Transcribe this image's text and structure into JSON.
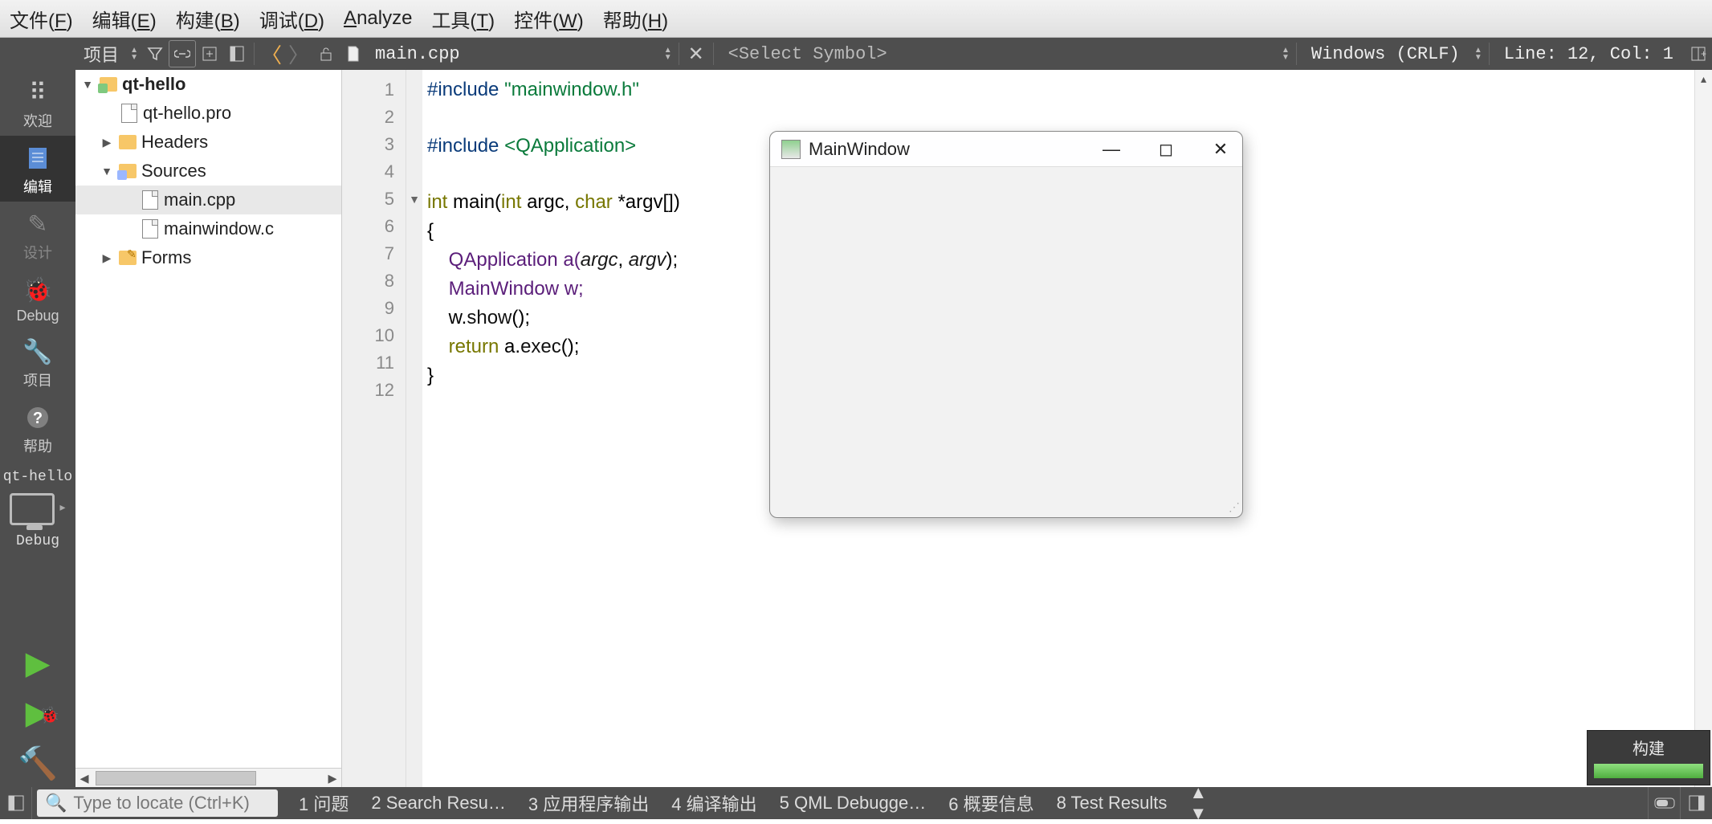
{
  "menu": {
    "file": "文件(",
    "file_k": "F",
    "edit": "编辑(",
    "edit_k": "E",
    "build": "构建(",
    "build_k": "B",
    "debug": "调试(",
    "debug_k": "D",
    "analyze": "Analyze",
    "analyze_k": "A",
    "tools": "工具(",
    "tools_k": "T",
    "widgets": "控件(",
    "widgets_k": "W",
    "help": "帮助(",
    "help_k": "H"
  },
  "toolbar": {
    "project_label": "项目",
    "open_file": "main.cpp",
    "select_symbol": "<Select Symbol>",
    "encoding": "Windows (CRLF)",
    "cursor": "Line: 12, Col: 1"
  },
  "activity": {
    "welcome": "欢迎",
    "edit": "编辑",
    "design": "设计",
    "debug": "Debug",
    "project": "项目",
    "help": "帮助",
    "kit": "qt-hello",
    "config": "Debug"
  },
  "tree": {
    "root": "qt-hello",
    "pro": "qt-hello.pro",
    "headers": "Headers",
    "sources": "Sources",
    "main": "main.cpp",
    "mw": "mainwindow.c",
    "forms": "Forms"
  },
  "gutter": [
    "1",
    "2",
    "3",
    "4",
    "5",
    "6",
    "7",
    "8",
    "9",
    "10",
    "11",
    "12"
  ],
  "code": {
    "l1a": "#include ",
    "l1b": "\"mainwindow.h\"",
    "l3a": "#include ",
    "l3b": "<QApplication>",
    "l5a": "int",
    "l5b": " main(",
    "l5c": "int",
    "l5d": " argc, ",
    "l5e": "char",
    "l5f": " *argv[])",
    "l6": "{",
    "l7a": "    QApplication a(",
    "l7b": "argc",
    "l7c": ", ",
    "l7d": "argv",
    "l7e": ");",
    "l8": "    MainWindow w;",
    "l9a": "    w.",
    "l9b": "show",
    "l9c": "();",
    "l10a": "    ",
    "l10b": "return",
    "l10c": " a.",
    "l10d": "exec",
    "l10e": "();",
    "l11": "}"
  },
  "runwin": {
    "title": "MainWindow"
  },
  "toast": {
    "title": "构建"
  },
  "locator": {
    "placeholder": "Type to locate (Ctrl+K)"
  },
  "tabs": {
    "t1": "1 问题",
    "t2": "2 Search Resu…",
    "t3": "3 应用程序输出",
    "t4": "4 编译输出",
    "t5": "5 QML Debugge…",
    "t6": "6 概要信息",
    "t8": "8 Test Results"
  }
}
